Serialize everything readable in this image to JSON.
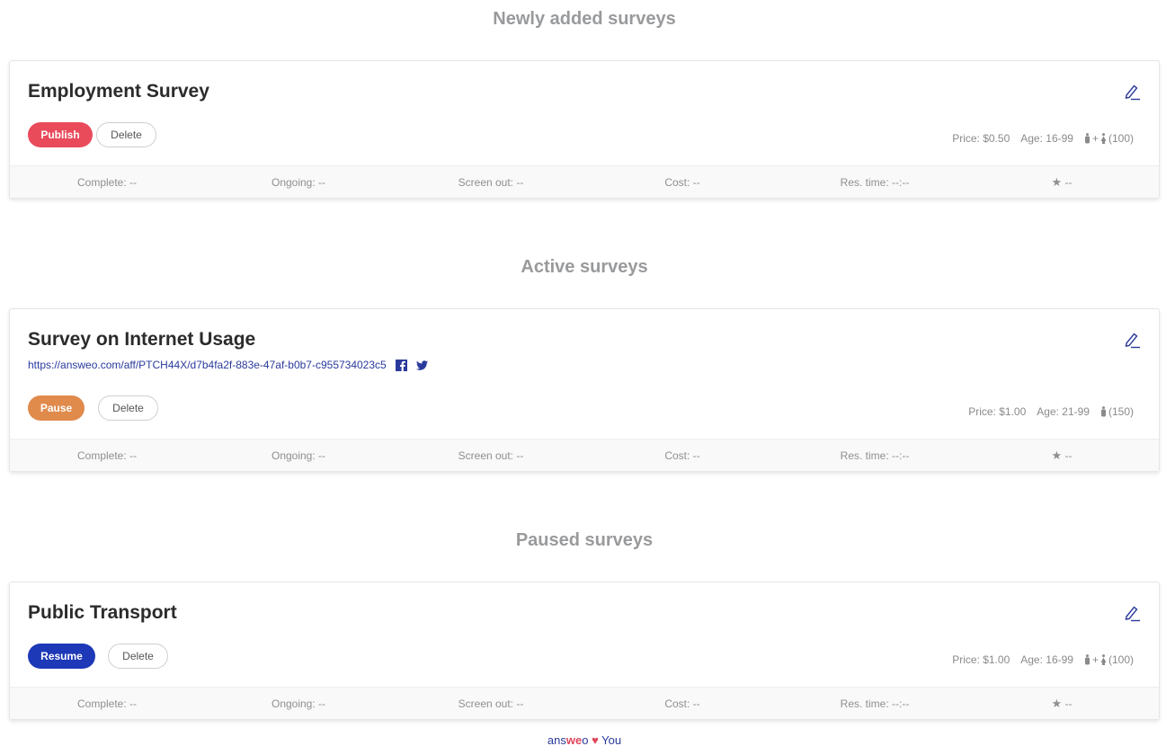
{
  "sections": {
    "newly_added": {
      "heading": "Newly added surveys",
      "survey": {
        "title": "Employment Survey",
        "primary_action": "Publish",
        "delete_label": "Delete",
        "price": "Price: $0.50",
        "age": "Age: 16-99",
        "audience_count": "(100)",
        "audience": "male+female"
      }
    },
    "active": {
      "heading": "Active surveys",
      "survey": {
        "title": "Survey on Internet Usage",
        "link": "https://answeo.com/aff/PTCH44X/d7b4fa2f-883e-47af-b0b7-c955734023c5",
        "primary_action": "Pause",
        "delete_label": "Delete",
        "price": "Price: $1.00",
        "age": "Age: 21-99",
        "audience_count": "(150)",
        "audience": "male"
      }
    },
    "paused": {
      "heading": "Paused surveys",
      "survey": {
        "title": "Public Transport",
        "primary_action": "Resume",
        "delete_label": "Delete",
        "price": "Price: $1.00",
        "age": "Age: 16-99",
        "audience_count": "(100)",
        "audience": "male+female"
      }
    }
  },
  "stats": {
    "complete": "Complete: --",
    "ongoing": "Ongoing: --",
    "screen_out": "Screen out: --",
    "cost": "Cost: --",
    "res_time": "Res. time: --:--",
    "rating": "--"
  },
  "footer": {
    "brand_part1": "ans",
    "brand_part2": "we",
    "brand_part3": "o",
    "suffix": "You"
  },
  "colors": {
    "publish": "#e94b5b",
    "pause": "#e08a4c",
    "resume": "#1d39b7",
    "link": "#2a3a9c"
  },
  "icons": [
    "edit-icon",
    "facebook-icon",
    "twitter-icon",
    "male-icon",
    "female-icon",
    "star-icon",
    "heart-icon"
  ]
}
